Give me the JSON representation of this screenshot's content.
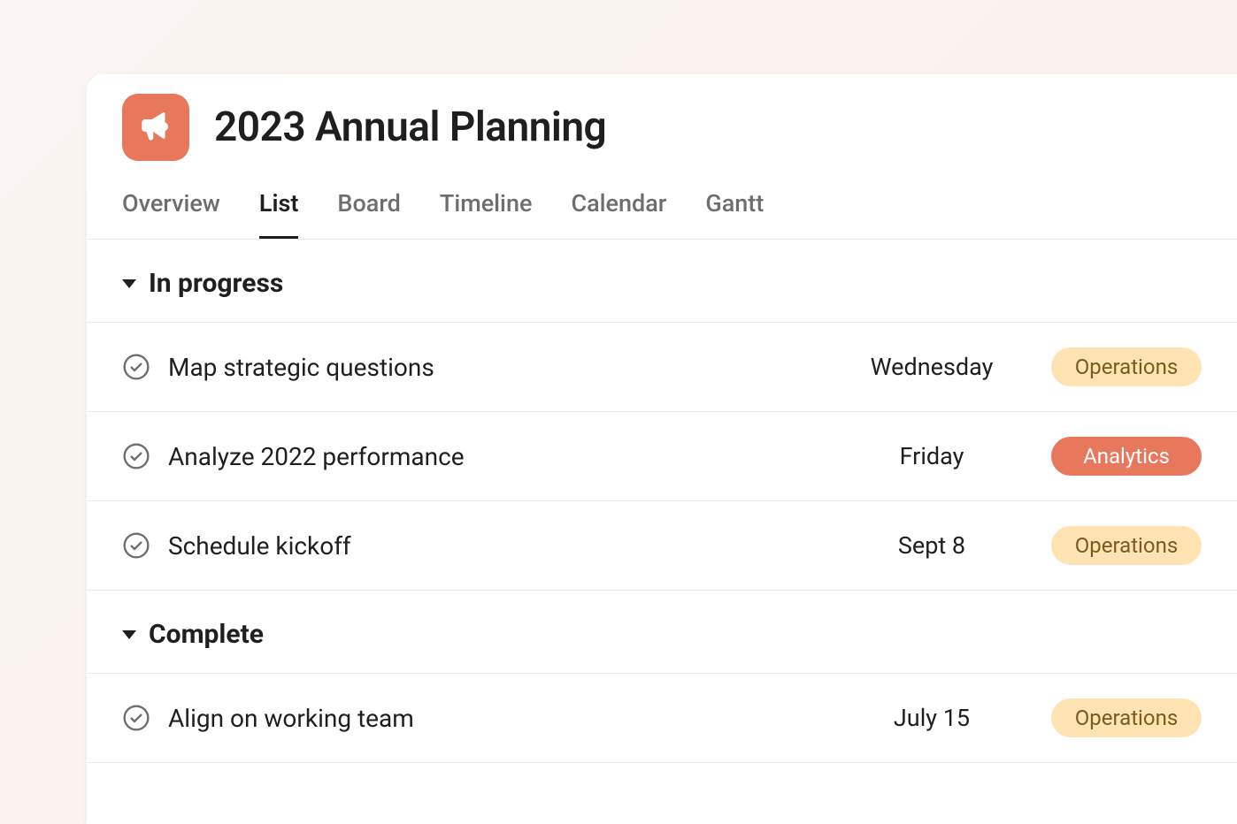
{
  "project": {
    "title": "2023 Annual Planning",
    "icon": "megaphone-icon"
  },
  "tabs": [
    {
      "label": "Overview",
      "active": false
    },
    {
      "label": "List",
      "active": true
    },
    {
      "label": "Board",
      "active": false
    },
    {
      "label": "Timeline",
      "active": false
    },
    {
      "label": "Calendar",
      "active": false
    },
    {
      "label": "Gantt",
      "active": false
    }
  ],
  "sections": [
    {
      "title": "In progress",
      "tasks": [
        {
          "name": "Map strategic questions",
          "date": "Wednesday",
          "tag": "Operations",
          "tag_style": "operations"
        },
        {
          "name": "Analyze 2022 performance",
          "date": "Friday",
          "tag": "Analytics",
          "tag_style": "analytics"
        },
        {
          "name": "Schedule kickoff",
          "date": "Sept 8",
          "tag": "Operations",
          "tag_style": "operations"
        }
      ]
    },
    {
      "title": "Complete",
      "tasks": [
        {
          "name": "Align on working team",
          "date": "July 15",
          "tag": "Operations",
          "tag_style": "operations"
        }
      ]
    }
  ]
}
